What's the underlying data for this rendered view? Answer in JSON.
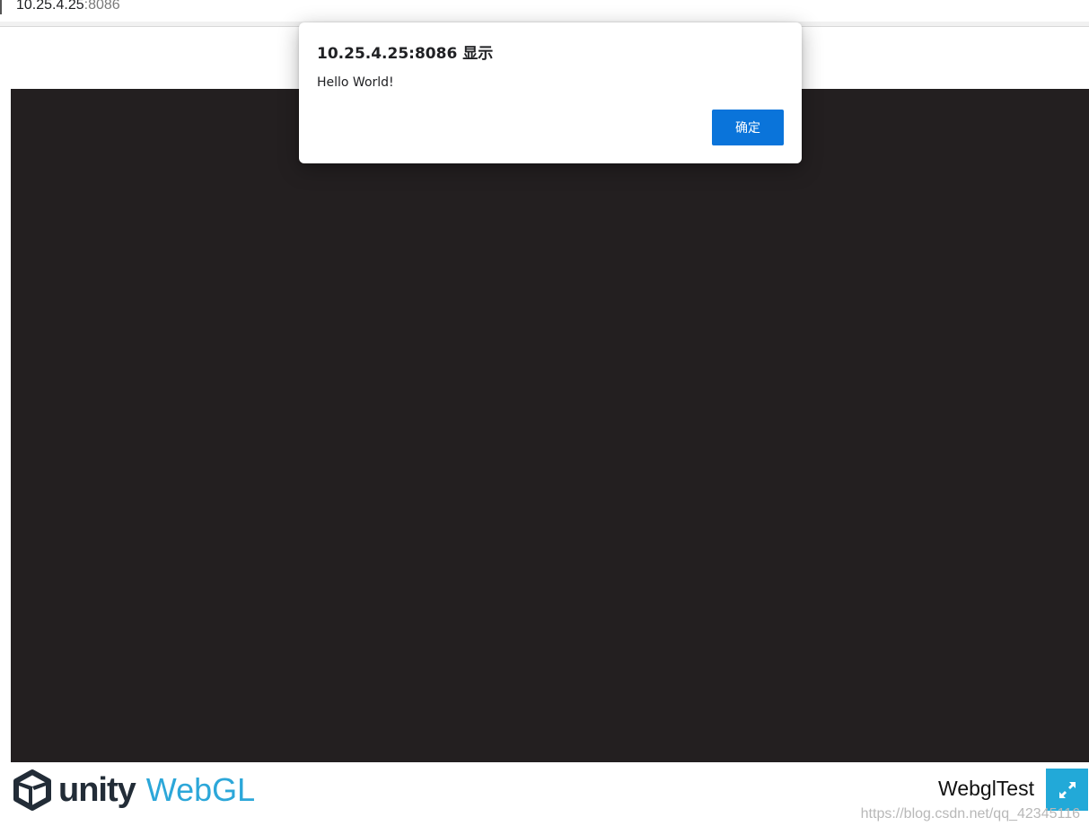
{
  "browser": {
    "url_host": "10.25.4.25",
    "url_port": ":8086"
  },
  "dialog": {
    "title": "10.25.4.25:8086 显示",
    "message": "Hello World!",
    "ok_label": "确定"
  },
  "footer": {
    "unity_logo_text": "unity",
    "webgl_text": "WebGL",
    "title": "WebglTest",
    "fullscreen_icon": "fullscreen-icon",
    "watermark": "https://blog.csdn.net/qq_42345116"
  },
  "colors": {
    "canvas": "#231f20",
    "accent_button": "#0a74da",
    "webgl_blue": "#2ca7d9",
    "fullscreen_bg": "#22a9d8"
  }
}
